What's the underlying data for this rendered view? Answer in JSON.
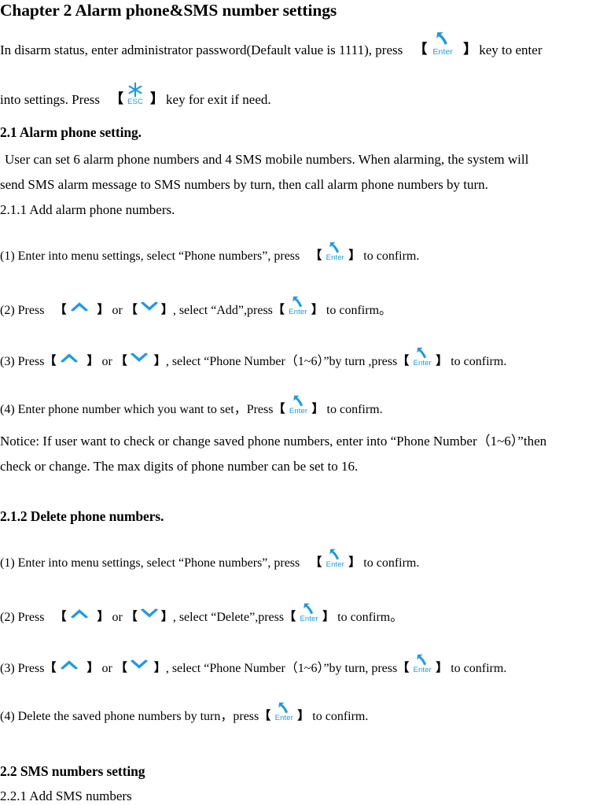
{
  "document": {
    "chapter_title": "Chapter 2 Alarm phone&SMS number settings",
    "intro": {
      "part1": "In disarm status, enter administrator password(Default value is 1111), press",
      "part2": "key to enter",
      "part3": "into settings. Press",
      "part4": "key for exit if need."
    },
    "section_2_1": {
      "heading": "2.1 Alarm phone setting.",
      "body_line1": "User can set 6 alarm phone numbers and 4 SMS mobile numbers. When alarming, the system will",
      "body_line2": "send SMS alarm message to SMS numbers by turn, then call alarm phone numbers by turn.",
      "subheading": "2.1.1 Add alarm phone numbers.",
      "steps": [
        {
          "before": "(1) Enter into menu settings, select “Phone numbers”, press",
          "after": "to confirm."
        },
        {
          "before": "(2) Press",
          "middle_or": "or",
          "middle_tail": ",  select “Add”,press",
          "after": "to confirm。"
        },
        {
          "before": "(3) Press",
          "middle_or": "or",
          "middle_tail": ",  select “Phone Number（1~6）”by turn ,press",
          "after": "to confirm."
        },
        {
          "before": "(4) Enter phone number which you want to set，Press",
          "after": "to confirm."
        }
      ],
      "notice_line1": "Notice: If user want to check or change saved phone numbers, enter into “Phone Number（1~6）”then",
      "notice_line2": "check or change. The max digits of phone number can be set to 16."
    },
    "section_2_1_2": {
      "heading": "2.1.2 Delete phone numbers.",
      "steps": [
        {
          "before": "(1) Enter into menu settings, select “Phone numbers”, press",
          "after": "to confirm."
        },
        {
          "before": "(2) Press",
          "middle_or": "or",
          "middle_tail": ",  select “Delete”,press",
          "after": "to confirm。"
        },
        {
          "before": "(3) Press",
          "middle_or": "or",
          "middle_tail": ",  select “Phone Number（1~6）”by turn, press",
          "after": "to confirm."
        },
        {
          "before": "(4) Delete the saved phone numbers by turn，press",
          "after": "to confirm."
        }
      ]
    },
    "section_2_2": {
      "heading": "2.2 SMS numbers setting",
      "subheading": "2.2.1 Add SMS numbers"
    },
    "keys": {
      "enter_label": "Enter",
      "esc_label": "ESC",
      "bracket_left": "【",
      "bracket_right": "】",
      "key_color": "#1b9ae6",
      "text_color": "#000000"
    }
  }
}
